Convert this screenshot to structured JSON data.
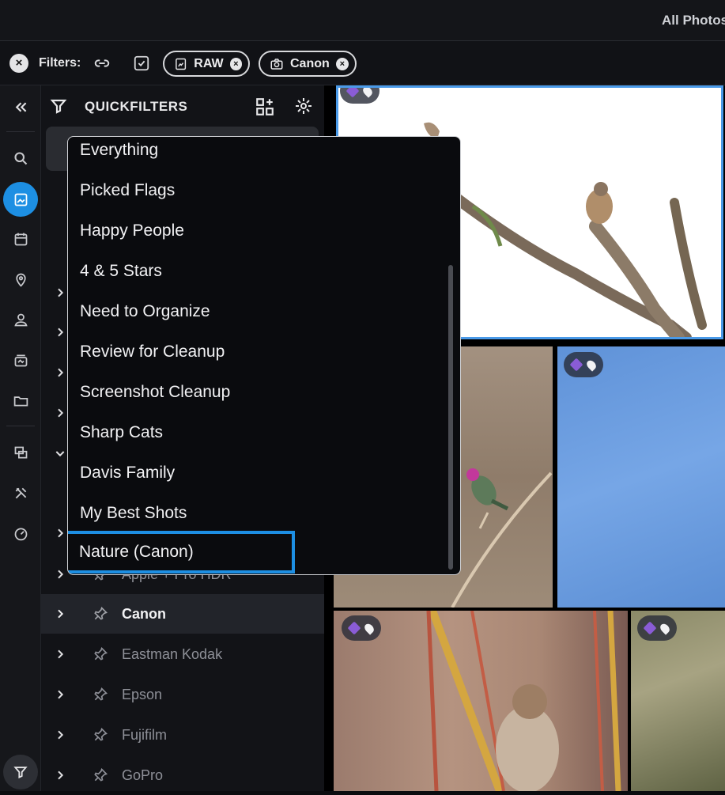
{
  "topbar": {
    "title": "All Photos"
  },
  "filters": {
    "label": "Filters:",
    "chips": [
      {
        "label": "RAW",
        "icon": "raw-file-icon"
      },
      {
        "label": "Canon",
        "icon": "camera-icon"
      }
    ]
  },
  "panel": {
    "title": "QUICKFILTERS",
    "tree": [
      {
        "label": "Apple + Pro HDR",
        "selected": false
      },
      {
        "label": "Canon",
        "selected": true
      },
      {
        "label": "Eastman Kodak",
        "selected": false
      },
      {
        "label": "Epson",
        "selected": false
      },
      {
        "label": "Fujifilm",
        "selected": false
      },
      {
        "label": "GoPro",
        "selected": false
      }
    ]
  },
  "dropdown": {
    "items": [
      "Everything",
      "Picked Flags",
      "Happy People",
      "4 & 5 Stars",
      "Need to Organize",
      "Review for Cleanup",
      "Screenshot Cleanup",
      "Sharp Cats",
      "Davis Family",
      "My Best Shots",
      "Nature (Canon)"
    ],
    "highlighted": "Nature (Canon)"
  },
  "colors": {
    "accent": "#1d8fe3",
    "tag": "#8a5cd6"
  }
}
